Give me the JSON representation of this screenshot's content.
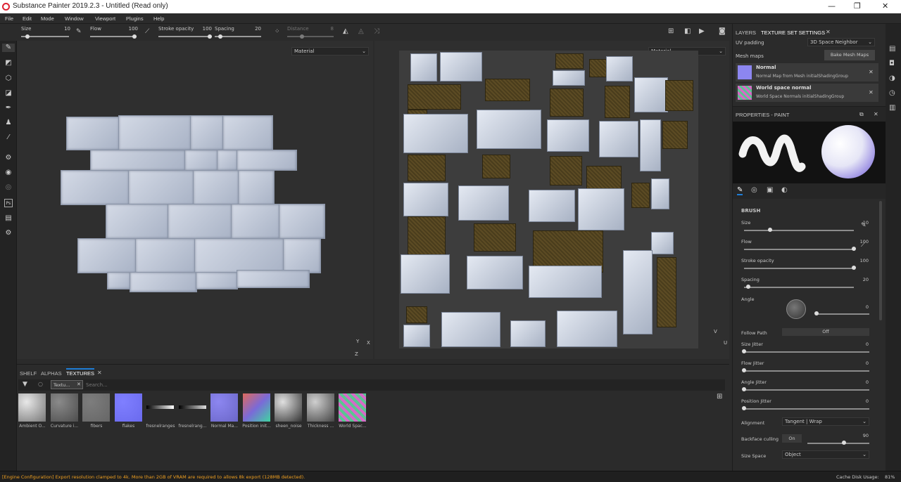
{
  "window": {
    "title": "Substance Painter 2019.2.3 - Untitled (Read only)",
    "minimize": "—",
    "maximize": "❐",
    "close": "✕"
  },
  "menu": [
    "File",
    "Edit",
    "Mode",
    "Window",
    "Viewport",
    "Plugins",
    "Help"
  ],
  "tool_options": {
    "size": {
      "label": "Size",
      "value": "10",
      "fraction": 0.1
    },
    "flow": {
      "label": "Flow",
      "value": "100",
      "fraction": 1.0
    },
    "stroke_opacity": {
      "label": "Stroke opacity",
      "value": "100",
      "fraction": 1.0
    },
    "spacing": {
      "label": "Spacing",
      "value": "20",
      "fraction": 0.08
    },
    "distance": {
      "label": "Distance",
      "value": "8",
      "fraction": 0.3
    }
  },
  "viewport3d": {
    "dropdown": "Material",
    "axis_y": "Y",
    "axis_x": "X",
    "axis_z": "Z"
  },
  "viewport2d": {
    "dropdown": "Material",
    "axis_v": "V",
    "axis_u": "U"
  },
  "shelf": {
    "tabs": [
      "SHELF",
      "ALPHAS",
      "TEXTURES"
    ],
    "active_tab": "TEXTURES",
    "filter_chip": "Textu...",
    "search_placeholder": "Search...",
    "items": [
      {
        "label": "Ambient O...",
        "color1": "#e8e8e8",
        "color2": "#777777"
      },
      {
        "label": "Curvature i...",
        "color1": "#8a8a8a",
        "color2": "#4d4d4d"
      },
      {
        "label": "fibers",
        "color1": "#7d7d7d",
        "color2": "#666666"
      },
      {
        "label": "flakes",
        "color1": "#7f7fff",
        "color2": "#6a6aee"
      },
      {
        "label": "fresnelranges",
        "color1": "#000000",
        "color2": "#ffffff"
      },
      {
        "label": "fresnelrang...",
        "color1": "#000000",
        "color2": "#dddddd"
      },
      {
        "label": "Normal Ma...",
        "color1": "#8c86f0",
        "color2": "#6b67c8"
      },
      {
        "label": "Position init...",
        "color1": "#e06a5c",
        "color2": "#3fd4a0"
      },
      {
        "label": "sheen_noise",
        "color1": "#e0e0e0",
        "color2": "#333333"
      },
      {
        "label": "Thickness ...",
        "color1": "#cfcfcf",
        "color2": "#444444"
      },
      {
        "label": "World Spac...",
        "color1": "#d868c8",
        "color2": "#58c890"
      }
    ]
  },
  "texture_set": {
    "tabs": [
      "LAYERS",
      "TEXTURE SET SETTINGS"
    ],
    "uv_padding_label": "UV padding",
    "uv_padding_value": "3D Space Neighbor",
    "mesh_maps_label": "Mesh maps",
    "bake_button": "Bake Mesh Maps",
    "maps": [
      {
        "name": "Normal",
        "desc": "Normal Map from Mesh initialShadingGroup"
      },
      {
        "name": "World space normal",
        "desc": "World Space Normals initialShadingGroup"
      }
    ]
  },
  "properties": {
    "title": "PROPERTIES - PAINT",
    "section": "BRUSH",
    "sliders": [
      {
        "label": "Size",
        "value": "10",
        "fraction": 0.24
      },
      {
        "label": "Flow",
        "value": "100",
        "fraction": 1.0
      },
      {
        "label": "Stroke opacity",
        "value": "100",
        "fraction": 1.0
      },
      {
        "label": "Spacing",
        "value": "20",
        "fraction": 0.04
      }
    ],
    "angle": {
      "label": "Angle",
      "value": "0"
    },
    "follow_path": {
      "label": "Follow Path",
      "value": "Off"
    },
    "jitters": [
      {
        "label": "Size Jitter",
        "value": "0"
      },
      {
        "label": "Flow Jitter",
        "value": "0"
      },
      {
        "label": "Angle Jitter",
        "value": "0"
      },
      {
        "label": "Position Jitter",
        "value": "0"
      }
    ],
    "alignment": {
      "label": "Alignment",
      "value": "Tangent | Wrap"
    },
    "backface": {
      "label": "Backface culling",
      "toggle": "On",
      "value": "90",
      "fraction": 0.6
    },
    "size_space": {
      "label": "Size Space",
      "value": "Object"
    }
  },
  "status": {
    "message": "[Engine Configuration] Export resolution clamped to 4k. More than 2GB of VRAM are required to allows 8k export (128MB detected).",
    "cache_label": "Cache Disk Usage:",
    "cache_value": "81%",
    "message_color": "#f0a020"
  }
}
